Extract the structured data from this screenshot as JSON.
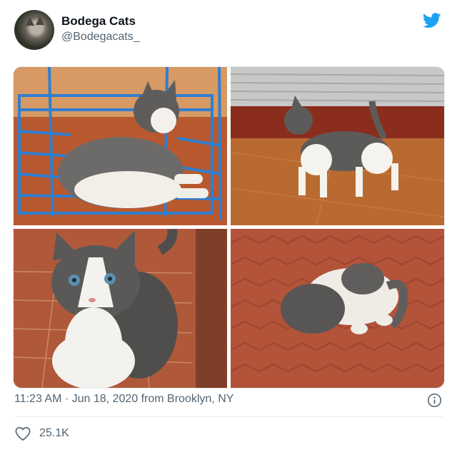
{
  "tweet": {
    "display_name": "Bodega Cats",
    "handle": "@Bodegacats_",
    "timestamp": "11:23 AM · Jun 18, 2020 from Brooklyn, NY",
    "likes": "25.1K"
  },
  "icons": {
    "brand": "twitter-bird-icon",
    "info": "info-icon",
    "like": "heart-icon"
  },
  "colors": {
    "twitter_blue": "#1da1f2",
    "secondary_text": "#536471",
    "primary_text": "#0f1419"
  }
}
